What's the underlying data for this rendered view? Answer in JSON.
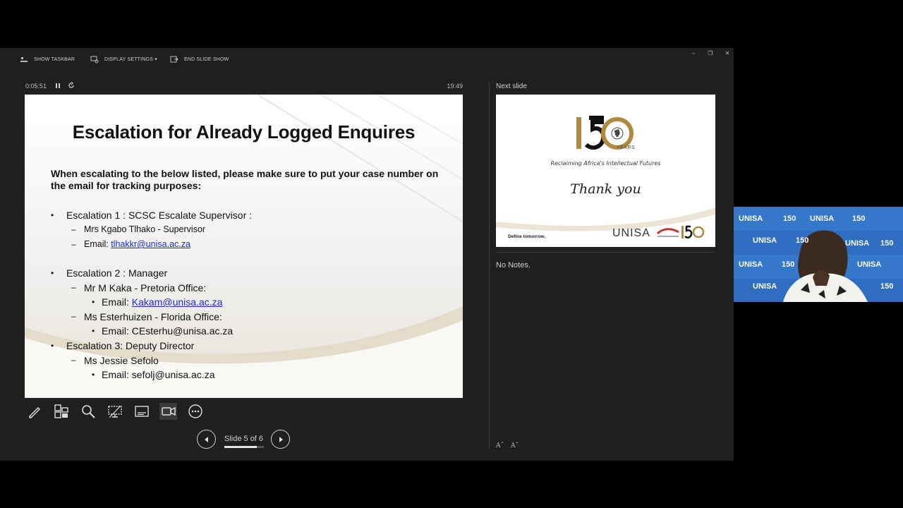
{
  "toolbar": {
    "show_taskbar": "SHOW TASKBAR",
    "display_settings": "DISPLAY SETTINGS ▾",
    "end_slide_show": "END SLIDE SHOW"
  },
  "window_controls": {
    "minimize": "–",
    "restore": "❐",
    "close": "✕"
  },
  "timer": {
    "elapsed": "0:05:51",
    "clock": "19:49"
  },
  "slide": {
    "title": "Escalation for Already Logged Enquires",
    "intro": "When escalating to the below listed, please make sure to put your case number on the email for tracking purposes:",
    "bullet": "•",
    "dash": "–",
    "esc1": "Escalation 1 : SCSC Escalate Supervisor :",
    "esc1_person": "Mrs Kgabo Tlhako - Supervisor",
    "esc1_email_label": "Email: ",
    "esc1_email": "tlhakkr@unisa.ac.za",
    "esc2": "Escalation 2 : Manager",
    "esc2_person1": "Mr M Kaka - Pretoria Office:",
    "esc2_email1_label": "Email: ",
    "esc2_email1": "Kakam@unisa.ac.za",
    "esc2_person2": "Ms Esterhuizen - Florida Office:",
    "esc2_email2": "Email: CEsterhu@unisa.ac.za",
    "esc3": "Escalation 3: Deputy Director",
    "esc3_person": "Ms Jessie Sefolo",
    "esc3_email": "Email: sefolj@unisa.ac.za"
  },
  "navigation": {
    "slide_counter": "Slide 5 of 6",
    "progress": 0.83
  },
  "next_slide": {
    "label": "Next slide",
    "years": "YEARS",
    "tagline": "Reclaiming Africa's Intellectual Futures",
    "thanks": "Thank you",
    "define": "Define tomorrow.",
    "unisa": "UNISA"
  },
  "notes": {
    "text": "No Notes."
  },
  "font_controls": {
    "increase": "Aˆ",
    "decrease": "Aˇ"
  },
  "webcam": {
    "brand": "UNISA",
    "logo_number": "150"
  },
  "colors": {
    "accent_gold": "#b08a3e",
    "unisa_blue": "#2f6dc0",
    "link_blue": "#1f2bd6"
  }
}
